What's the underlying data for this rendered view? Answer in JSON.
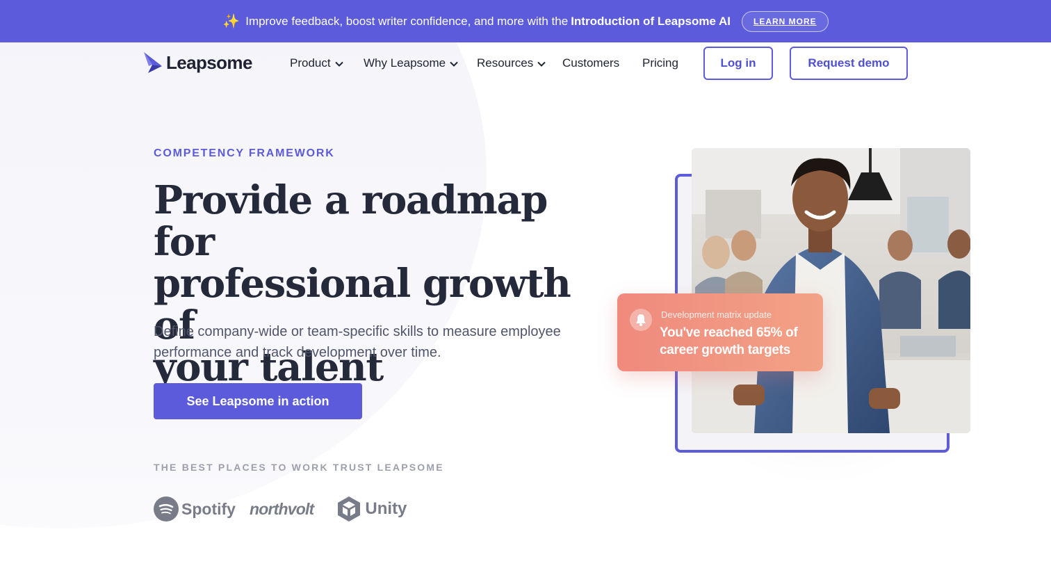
{
  "banner": {
    "sparkle_icon": "sparkles-icon",
    "text": "Improve feedback, boost writer confidence, and more with the",
    "highlight": "Introduction of Leapsome AI",
    "button_label": "LEARN MORE"
  },
  "nav": {
    "logo_text": "Leapsome",
    "items": [
      {
        "label": "Product",
        "has_dropdown": true
      },
      {
        "label": "Why Leapsome",
        "has_dropdown": true
      },
      {
        "label": "Resources",
        "has_dropdown": true
      },
      {
        "label": "Customers",
        "has_dropdown": false
      },
      {
        "label": "Pricing",
        "has_dropdown": false
      }
    ],
    "login_label": "Log in",
    "demo_label": "Request demo"
  },
  "hero": {
    "eyebrow": "COMPETENCY FRAMEWORK",
    "headline_lines": [
      "Provide a roadmap for",
      "professional growth of",
      "your talent"
    ],
    "subtext_lines": [
      "Define company-wide or team-specific skills to measure employee",
      "performance and track development over time."
    ],
    "cta_label": "See Leapsome in action",
    "trust_label": "THE BEST PLACES TO WORK TRUST LEAPSOME",
    "brands": [
      "Spotify",
      "northvolt",
      "Unity"
    ]
  },
  "notification": {
    "icon": "bell-icon",
    "title": "Development matrix update",
    "message": "You've reached 65% of career growth targets"
  },
  "colors": {
    "brand": "#5b5bdb",
    "text_dark": "#252a3a",
    "notification_gradient_start": "#f08a7d",
    "notification_gradient_end": "#f2a286"
  }
}
